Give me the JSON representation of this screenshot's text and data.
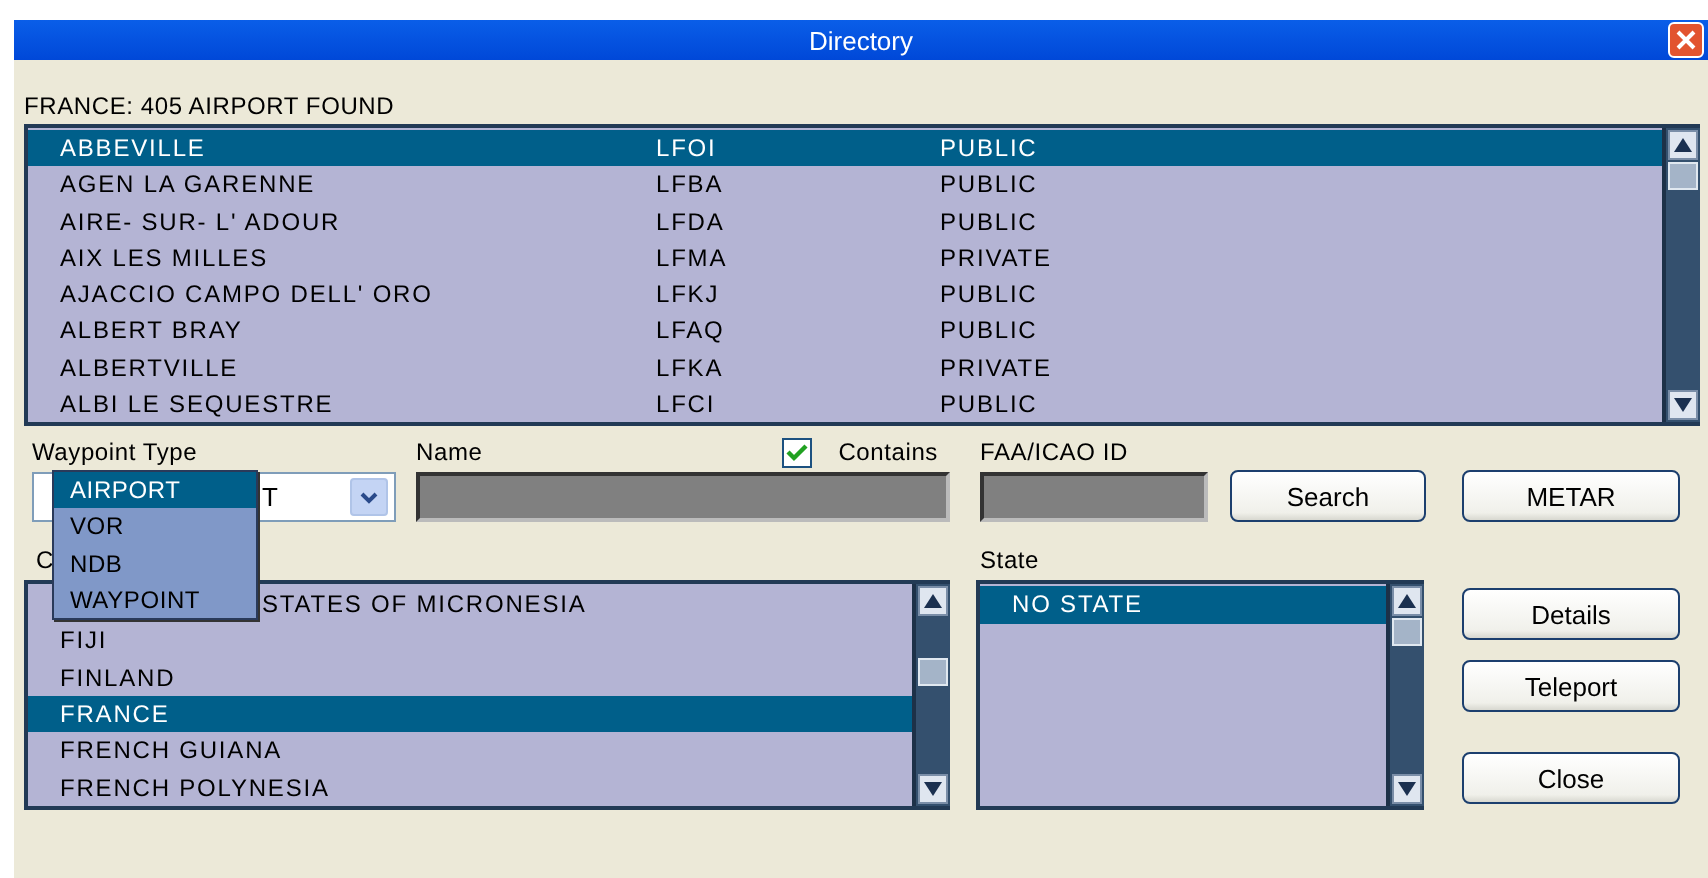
{
  "window": {
    "title": "Directory"
  },
  "result_label": "FRANCE: 405 AIRPORT FOUND",
  "airports": [
    {
      "name": "ABBEVILLE",
      "id": "LFOI",
      "type": "PUBLIC",
      "selected": true
    },
    {
      "name": "AGEN LA GARENNE",
      "id": "LFBA",
      "type": "PUBLIC",
      "selected": false
    },
    {
      "name": "AIRE- SUR- L' ADOUR",
      "id": "LFDA",
      "type": "PUBLIC",
      "selected": false
    },
    {
      "name": "AIX LES MILLES",
      "id": "LFMA",
      "type": "PRIVATE",
      "selected": false
    },
    {
      "name": "AJACCIO CAMPO DELL' ORO",
      "id": "LFKJ",
      "type": "PUBLIC",
      "selected": false
    },
    {
      "name": "ALBERT BRAY",
      "id": "LFAQ",
      "type": "PUBLIC",
      "selected": false
    },
    {
      "name": "ALBERTVILLE",
      "id": "LFKA",
      "type": "PRIVATE",
      "selected": false
    },
    {
      "name": "ALBI LE SEQUESTRE",
      "id": "LFCI",
      "type": "PUBLIC",
      "selected": false
    }
  ],
  "waypoint_type": {
    "label": "Waypoint Type",
    "value": "T",
    "options": [
      {
        "label": "AIRPORT",
        "selected": true
      },
      {
        "label": "VOR",
        "selected": false
      },
      {
        "label": "NDB",
        "selected": false
      },
      {
        "label": "WAYPOINT",
        "selected": false
      }
    ]
  },
  "name_field": {
    "label": "Name"
  },
  "contains": {
    "label": "Contains",
    "checked": true
  },
  "faa_field": {
    "label": "FAA/ICAO ID"
  },
  "search_button": "Search",
  "metar_button": "METAR",
  "country": {
    "label": "C",
    "items": [
      {
        "label": "STATES OF MICRONESIA",
        "selected": false,
        "partly_hidden": true
      },
      {
        "label": "FIJI",
        "selected": false
      },
      {
        "label": "FINLAND",
        "selected": false
      },
      {
        "label": "FRANCE",
        "selected": true
      },
      {
        "label": "FRENCH GUIANA",
        "selected": false
      },
      {
        "label": "FRENCH POLYNESIA",
        "selected": false
      }
    ]
  },
  "state": {
    "label": "State",
    "items": [
      {
        "label": "NO STATE",
        "selected": true
      }
    ]
  },
  "side_buttons": [
    "Details",
    "Teleport",
    "Close"
  ]
}
